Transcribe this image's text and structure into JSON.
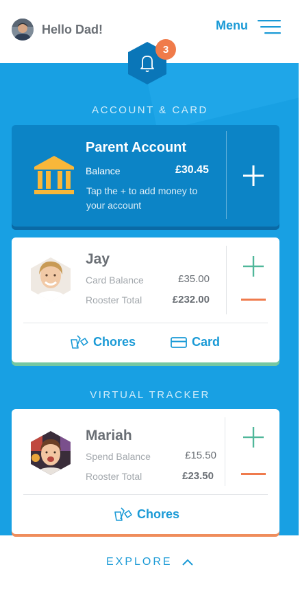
{
  "header": {
    "greeting": "Hello Dad!",
    "menu_label": "Menu",
    "avatar_icon": "user-avatar",
    "menu_icon": "hamburger-icon"
  },
  "notifications": {
    "count": "3",
    "icon": "bell-icon"
  },
  "sections": {
    "account_card": "ACCOUNT & CARD",
    "virtual_tracker": "VIRTUAL TRACKER"
  },
  "parent_account": {
    "title": "Parent Account",
    "balance_label": "Balance",
    "balance_value": "£30.45",
    "hint": "Tap the + to add money to your account",
    "icon": "bank-icon"
  },
  "children": [
    {
      "name": "Jay",
      "row1_label": "Card Balance",
      "row1_value": "£35.00",
      "row2_label": "Rooster Total",
      "row2_value": "£232.00",
      "action1": "Chores",
      "action2": "Card"
    },
    {
      "name": "Mariah",
      "row1_label": "Spend Balance",
      "row1_value": "£15.50",
      "row2_label": "Rooster Total",
      "row2_value": "£23.50",
      "action1": "Chores"
    }
  ],
  "footer": {
    "explore_label": "EXPLORE"
  },
  "colors": {
    "brand_blue": "#18a0e3",
    "card_blue": "#0c84c6",
    "accent_green": "#4fb79a",
    "accent_orange": "#ef7b4d",
    "badge_orange": "#f07b4a",
    "bank_yellow": "#f8b73a"
  }
}
